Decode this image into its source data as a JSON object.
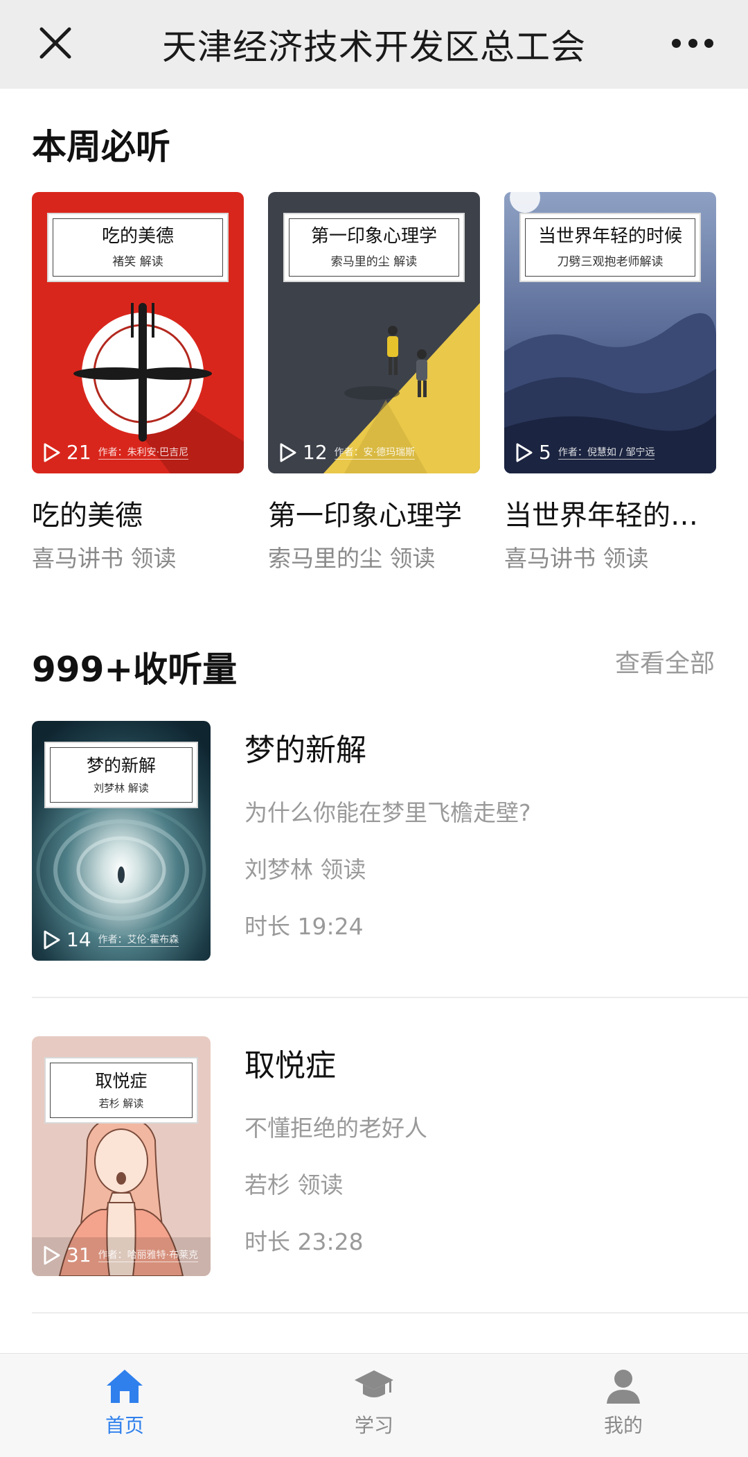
{
  "header": {
    "title": "天津经济技术开发区总工会"
  },
  "weekly": {
    "title": "本周必听",
    "cards": [
      {
        "cover_title": "吃的美德",
        "cover_sub": "褚笑 解读",
        "plays": "21",
        "author": "作者：朱利安·巴吉尼",
        "name": "吃的美德",
        "reader": "喜马讲书 领读"
      },
      {
        "cover_title": "第一印象心理学",
        "cover_sub": "索马里的尘 解读",
        "plays": "12",
        "author": "作者：安·德玛瑞斯",
        "name": "第一印象心理学",
        "reader": "索马里的尘 领读"
      },
      {
        "cover_title": "当世界年轻的时候",
        "cover_sub": "刀劈三观抱老师解读",
        "plays": "5",
        "author": "作者：倪慧如 / 邹宁远",
        "name": "当世界年轻的时候",
        "reader": "喜马讲书 领读"
      }
    ]
  },
  "popular": {
    "title": "999+收听量",
    "see_all": "查看全部",
    "items": [
      {
        "cover_title": "梦的新解",
        "cover_sub": "刘梦林 解读",
        "plays": "14",
        "author": "作者：艾伦·霍布森",
        "title": "梦的新解",
        "desc": "为什么你能在梦里飞檐走壁?",
        "reader": "刘梦林 领读",
        "duration": "时长 19:24"
      },
      {
        "cover_title": "取悦症",
        "cover_sub": "若杉 解读",
        "plays": "31",
        "author": "作者：哈丽雅特·布莱克",
        "title": "取悦症",
        "desc": "不懂拒绝的老好人",
        "reader": "若杉 领读",
        "duration": "时长 23:28"
      }
    ]
  },
  "nav": {
    "items": [
      {
        "label": "首页",
        "icon": "home-icon",
        "active": true
      },
      {
        "label": "学习",
        "icon": "graduation-cap-icon",
        "active": false
      },
      {
        "label": "我的",
        "icon": "user-icon",
        "active": false
      }
    ]
  },
  "colors": {
    "accent": "#2f80ed",
    "header_bg": "#ededed",
    "muted": "#9a9a9a"
  }
}
